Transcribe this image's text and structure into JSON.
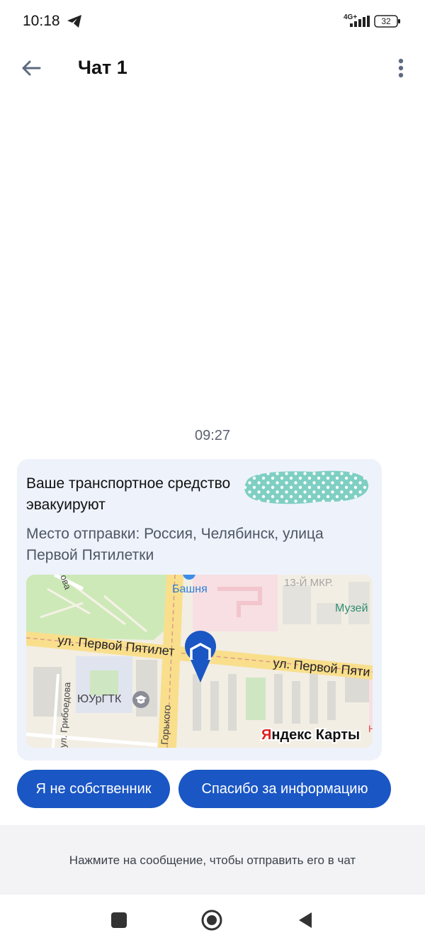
{
  "status": {
    "time": "10:18",
    "network": "4G+",
    "battery": "32"
  },
  "header": {
    "title": "Чат 1"
  },
  "chat": {
    "timestamp": "09:27",
    "message": {
      "text": "Ваше транспортное средство",
      "text_line2": "эвакуируют",
      "location": "Место отправки: Россия, Челябинск, улица Первой Пятилетки"
    },
    "map": {
      "labels": {
        "bashnya": "Башня",
        "district": "13-Й МКР.",
        "museum": "Музей",
        "street_left": "ул. Первой Пятилет",
        "street_right": "ул. Первой Пяти",
        "college": "ЮУрГТК",
        "griboedova": "ул. Грибоедова",
        "gorkogo": "Горького",
        "top_fragment": "ова",
        "h_fragment": "Н"
      },
      "logo": "Яндекс Карты"
    }
  },
  "quick_replies": [
    {
      "label": "Я не собственник"
    },
    {
      "label": "Спасибо за информацию"
    }
  ],
  "hint": "Нажмите на сообщение, чтобы отправить его в чат",
  "colors": {
    "accent": "#1a56c4",
    "bubble": "#eef2fb",
    "pin": "#1a56c4"
  }
}
